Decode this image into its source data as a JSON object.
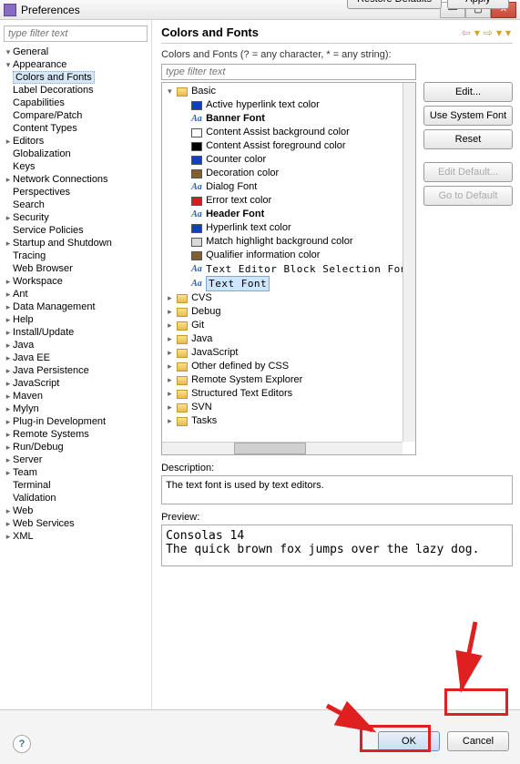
{
  "window": {
    "title": "Preferences"
  },
  "left_filter_placeholder": "type filter text",
  "nav": [
    {
      "label": "General",
      "exp": "▾",
      "ind": 0
    },
    {
      "label": "Appearance",
      "exp": "▾",
      "ind": 1
    },
    {
      "label": "Colors and Fonts",
      "exp": "",
      "ind": 2,
      "selected": true
    },
    {
      "label": "Label Decorations",
      "exp": "",
      "ind": 2
    },
    {
      "label": "Capabilities",
      "exp": "",
      "ind": 1
    },
    {
      "label": "Compare/Patch",
      "exp": "",
      "ind": 1
    },
    {
      "label": "Content Types",
      "exp": "",
      "ind": 1
    },
    {
      "label": "Editors",
      "exp": "▸",
      "ind": 1
    },
    {
      "label": "Globalization",
      "exp": "",
      "ind": 1
    },
    {
      "label": "Keys",
      "exp": "",
      "ind": 1
    },
    {
      "label": "Network Connections",
      "exp": "▸",
      "ind": 1
    },
    {
      "label": "Perspectives",
      "exp": "",
      "ind": 1
    },
    {
      "label": "Search",
      "exp": "",
      "ind": 1
    },
    {
      "label": "Security",
      "exp": "▸",
      "ind": 1
    },
    {
      "label": "Service Policies",
      "exp": "",
      "ind": 1
    },
    {
      "label": "Startup and Shutdown",
      "exp": "▸",
      "ind": 1
    },
    {
      "label": "Tracing",
      "exp": "",
      "ind": 1
    },
    {
      "label": "Web Browser",
      "exp": "",
      "ind": 1
    },
    {
      "label": "Workspace",
      "exp": "▸",
      "ind": 1
    },
    {
      "label": "Ant",
      "exp": "▸",
      "ind": 0
    },
    {
      "label": "Data Management",
      "exp": "▸",
      "ind": 0
    },
    {
      "label": "Help",
      "exp": "▸",
      "ind": 0
    },
    {
      "label": "Install/Update",
      "exp": "▸",
      "ind": 0
    },
    {
      "label": "Java",
      "exp": "▸",
      "ind": 0
    },
    {
      "label": "Java EE",
      "exp": "▸",
      "ind": 0
    },
    {
      "label": "Java Persistence",
      "exp": "▸",
      "ind": 0
    },
    {
      "label": "JavaScript",
      "exp": "▸",
      "ind": 0
    },
    {
      "label": "Maven",
      "exp": "▸",
      "ind": 0
    },
    {
      "label": "Mylyn",
      "exp": "▸",
      "ind": 0
    },
    {
      "label": "Plug-in Development",
      "exp": "▸",
      "ind": 0
    },
    {
      "label": "Remote Systems",
      "exp": "▸",
      "ind": 0
    },
    {
      "label": "Run/Debug",
      "exp": "▸",
      "ind": 0
    },
    {
      "label": "Server",
      "exp": "▸",
      "ind": 0
    },
    {
      "label": "Team",
      "exp": "▸",
      "ind": 0
    },
    {
      "label": "Terminal",
      "exp": "",
      "ind": 1
    },
    {
      "label": "Validation",
      "exp": "",
      "ind": 1
    },
    {
      "label": "Web",
      "exp": "▸",
      "ind": 0
    },
    {
      "label": "Web Services",
      "exp": "▸",
      "ind": 0
    },
    {
      "label": "XML",
      "exp": "▸",
      "ind": 0
    }
  ],
  "right": {
    "heading": "Colors and Fonts",
    "hint": "Colors and Fonts (? = any character, * = any string):",
    "filter_placeholder": "type filter text",
    "desc_label": "Description:",
    "desc_text": "The text font is used by text editors.",
    "preview_label": "Preview:",
    "preview_line1": "Consolas 14",
    "preview_line2": "The quick brown fox jumps over the lazy dog."
  },
  "cf_items": [
    {
      "label": "Basic",
      "exp": "▾",
      "ind": 1,
      "icon": "folder"
    },
    {
      "label": "Active hyperlink text color",
      "ind": 2,
      "color": "#1040c0"
    },
    {
      "label": "Banner Font",
      "ind": 2,
      "icon": "aa",
      "bold": true
    },
    {
      "label": "Content Assist background color",
      "ind": 2,
      "color": "#ffffff",
      "white": true
    },
    {
      "label": "Content Assist foreground color",
      "ind": 2,
      "color": "#000000"
    },
    {
      "label": "Counter color",
      "ind": 2,
      "color": "#1040c0"
    },
    {
      "label": "Decoration color",
      "ind": 2,
      "color": "#806030"
    },
    {
      "label": "Dialog Font",
      "ind": 2,
      "icon": "aa"
    },
    {
      "label": "Error text color",
      "ind": 2,
      "color": "#d02020"
    },
    {
      "label": "Header Font",
      "ind": 2,
      "icon": "aa",
      "bold": true
    },
    {
      "label": "Hyperlink text color",
      "ind": 2,
      "color": "#1040c0"
    },
    {
      "label": "Match highlight background color",
      "ind": 2,
      "color": "#d8d8d8"
    },
    {
      "label": "Qualifier information color",
      "ind": 2,
      "color": "#806030"
    },
    {
      "label": "Text Editor Block Selection Font",
      "ind": 2,
      "icon": "aa",
      "mono": true
    },
    {
      "label": "Text Font",
      "ind": 2,
      "icon": "aa",
      "mono": true,
      "selected": true
    },
    {
      "label": "CVS",
      "exp": "▸",
      "ind": 1,
      "icon": "folder"
    },
    {
      "label": "Debug",
      "exp": "▸",
      "ind": 1,
      "icon": "folder"
    },
    {
      "label": "Git",
      "exp": "▸",
      "ind": 1,
      "icon": "folder"
    },
    {
      "label": "Java",
      "exp": "▸",
      "ind": 1,
      "icon": "folder"
    },
    {
      "label": "JavaScript",
      "exp": "▸",
      "ind": 1,
      "icon": "folder"
    },
    {
      "label": "Other defined by CSS",
      "exp": "▸",
      "ind": 1,
      "icon": "folder"
    },
    {
      "label": "Remote System Explorer",
      "exp": "▸",
      "ind": 1,
      "icon": "folder"
    },
    {
      "label": "Structured Text Editors",
      "exp": "▸",
      "ind": 1,
      "icon": "folder"
    },
    {
      "label": "SVN",
      "exp": "▸",
      "ind": 1,
      "icon": "folder"
    },
    {
      "label": "Tasks",
      "exp": "▸",
      "ind": 1,
      "icon": "folder"
    }
  ],
  "buttons": {
    "edit": "Edit...",
    "use_system": "Use System Font",
    "reset": "Reset",
    "edit_default": "Edit Default...",
    "go_default": "Go to Default",
    "restore": "Restore Defaults",
    "apply": "Apply",
    "ok": "OK",
    "cancel": "Cancel"
  }
}
